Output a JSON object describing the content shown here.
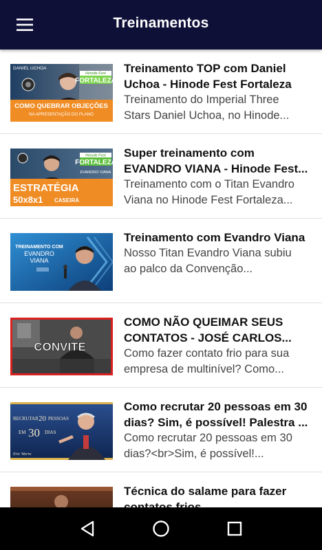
{
  "app_bar": {
    "title": "Treinamentos",
    "menu_icon": "hamburger-menu-icon",
    "background": "#0f1038"
  },
  "items": [
    {
      "title_lines": [
        "Treinamento TOP com Daniel",
        "Uchoa - Hinode Fest Fortaleza"
      ],
      "desc_lines": [
        "Treinamento do Imperial Three",
        "Stars Daniel Uchoa, no Hinode..."
      ],
      "thumb": {
        "top_left": "DANIEL UCHOA",
        "banner_top": "Hinode Fest",
        "banner_main": "FORTALEZA",
        "caption": "COMO QUEBRAR OBJEÇÕES",
        "subcaption": "NA APRESENTAÇÃO DO PLANO"
      }
    },
    {
      "title_lines": [
        "Super treinamento com",
        "EVANDRO VIANA - Hinode Fest..."
      ],
      "desc_lines": [
        "Treinamento com o Titan Evandro",
        "Viana no Hinode Fest Fortaleza..."
      ],
      "thumb": {
        "banner_top": "Hinode Fest",
        "banner_main": "FORTALEZA",
        "name": "EVANDRO VIANA",
        "caption": "ESTRATÉGIA",
        "subcaption_main": "50x8x1",
        "subcaption_side": "CASEIRA"
      }
    },
    {
      "title_lines": [
        "Treinamento com Evandro Viana"
      ],
      "desc_lines": [
        "Nosso Titan Evandro Viana subiu",
        "ao palco da Convenção..."
      ],
      "thumb": {
        "line1": "TREINAMENTO COM",
        "line2": "EVANDRO",
        "line3": "VIANA"
      }
    },
    {
      "title_lines": [
        "COMO NÃO QUEIMAR SEUS",
        "CONTATOS - JOSÉ CARLOS..."
      ],
      "desc_lines": [
        "Como fazer contato frio para sua",
        "empresa de multinível? Como..."
      ],
      "thumb": {
        "caption": "CONVITE"
      }
    },
    {
      "title_lines": [
        "Como recrutar 20 pessoas em 30",
        "dias? Sim, é possível! Palestra ..."
      ],
      "desc_lines": [
        "Como recrutar 20 pessoas em 30",
        "dias?<br>Sim, é possível!..."
      ],
      "thumb": {
        "line1_a": "RECRUTAR",
        "line1_num": "20",
        "line1_b": "PESSOAS",
        "line2_a": "EM",
        "line2_num": "30",
        "line2_b": "DIAS",
        "signature": "Eric Worre"
      }
    },
    {
      "title_lines": [
        "Técnica do salame para fazer",
        "contatos frios"
      ],
      "desc_lines": [
        ""
      ],
      "thumb": {}
    }
  ],
  "nav_bar": {
    "back_icon": "back-triangle-icon",
    "home_icon": "home-circle-icon",
    "recents_icon": "recents-square-icon"
  }
}
